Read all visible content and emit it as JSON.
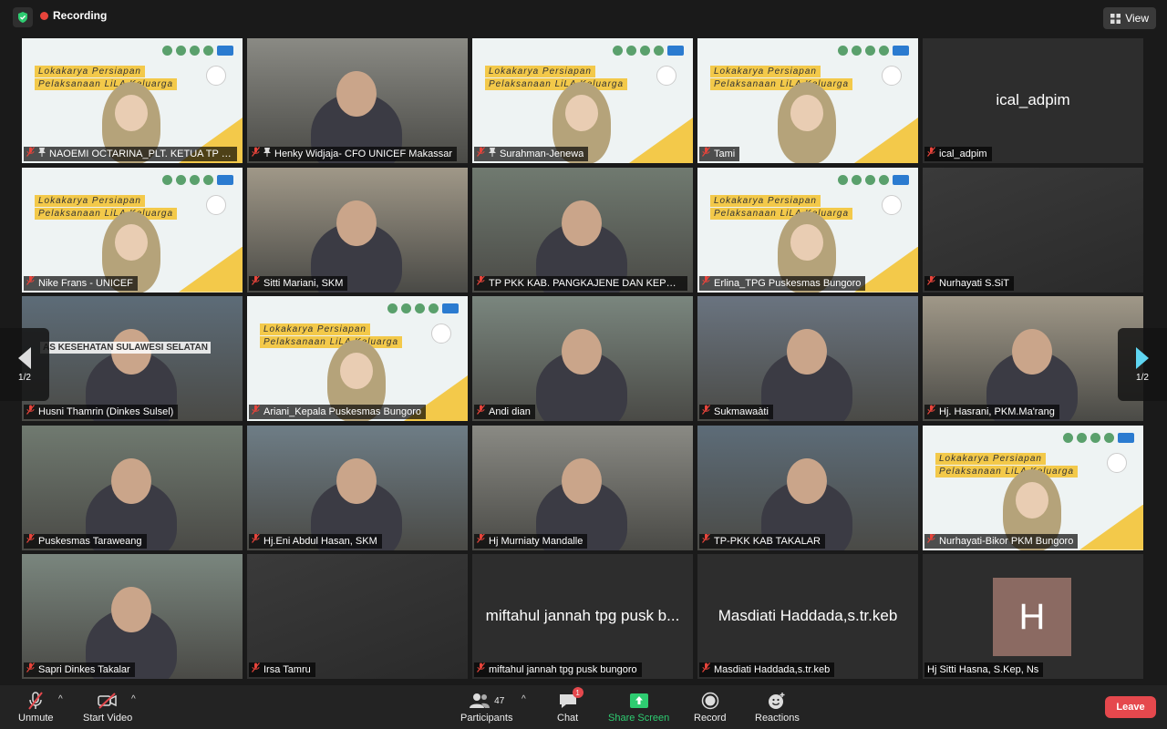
{
  "topbar": {
    "recording_label": "Recording",
    "view_label": "View"
  },
  "slide_text": {
    "line1": "Lokakarya Persiapan",
    "line2": "Pelaksanaan LiLA Keluarga"
  },
  "tiles": [
    {
      "name": "NAOEMI OCTARINA_PLT. KETUA TP PKK...",
      "muted": true,
      "pinned": true,
      "kind": "slide",
      "active": true
    },
    {
      "name": "Henky Widjaja- CFO UNICEF Makassar",
      "muted": true,
      "pinned": true,
      "kind": "video"
    },
    {
      "name": "Surahman-Jenewa",
      "muted": true,
      "pinned": true,
      "kind": "slide"
    },
    {
      "name": "Tami",
      "muted": true,
      "kind": "slide"
    },
    {
      "name": "ical_adpim",
      "muted": true,
      "kind": "name",
      "display": "ical_adpim"
    },
    {
      "name": "Nike Frans - UNICEF",
      "muted": true,
      "kind": "slide"
    },
    {
      "name": "Sitti Mariani, SKM",
      "muted": true,
      "kind": "video"
    },
    {
      "name": "TP PKK KAB. PANGKAJENE DAN KEPULA...",
      "muted": true,
      "kind": "video"
    },
    {
      "name": "Erlina_TPG Puskesmas Bungoro",
      "muted": true,
      "kind": "slide"
    },
    {
      "name": "Nurhayati S.SiT",
      "muted": true,
      "kind": "dark"
    },
    {
      "name": "Husni Thamrin (Dinkes Sulsel)",
      "muted": true,
      "kind": "video",
      "caption": "AS KESEHATAN SULAWESI SELATAN"
    },
    {
      "name": "Ariani_Kepala Puskesmas Bungoro",
      "muted": true,
      "kind": "slide"
    },
    {
      "name": "Andi dian",
      "muted": true,
      "kind": "video"
    },
    {
      "name": "Sukmawaàti",
      "muted": true,
      "kind": "video"
    },
    {
      "name": "Hj. Hasrani, PKM.Ma'rang",
      "muted": true,
      "kind": "video"
    },
    {
      "name": "Puskesmas Taraweang",
      "muted": true,
      "kind": "video"
    },
    {
      "name": "Hj.Eni Abdul Hasan, SKM",
      "muted": true,
      "kind": "video"
    },
    {
      "name": "Hj Murniaty Mandalle",
      "muted": true,
      "kind": "video"
    },
    {
      "name": "TP-PKK KAB TAKALAR",
      "muted": true,
      "kind": "video"
    },
    {
      "name": "Nurhayati-Bikor PKM Bungoro",
      "muted": true,
      "kind": "slide"
    },
    {
      "name": "Sapri Dinkes Takalar",
      "muted": true,
      "kind": "video"
    },
    {
      "name": "Irsa Tamru",
      "muted": true,
      "kind": "dark"
    },
    {
      "name": "miftahul jannah tpg pusk bungoro",
      "muted": true,
      "kind": "name",
      "display": "miftahul jannah tpg pusk b..."
    },
    {
      "name": "Masdiati Haddada,s.tr.keb",
      "muted": true,
      "kind": "name",
      "display": "Masdiati Haddada,s.tr.keb"
    },
    {
      "name": "Hj Sitti Hasna, S.Kep, Ns",
      "muted": false,
      "kind": "avatar",
      "initial": "H"
    }
  ],
  "pager": {
    "left": "1/2",
    "right": "1/2"
  },
  "toolbar": {
    "unmute": "Unmute",
    "start_video": "Start Video",
    "participants": "Participants",
    "participants_count": "47",
    "chat": "Chat",
    "chat_badge": "1",
    "share_screen": "Share Screen",
    "record": "Record",
    "reactions": "Reactions",
    "leave": "Leave"
  },
  "colors": {
    "accent_green": "#2ecc71",
    "leave_red": "#e5484d",
    "active_border": "#c4e24a"
  }
}
